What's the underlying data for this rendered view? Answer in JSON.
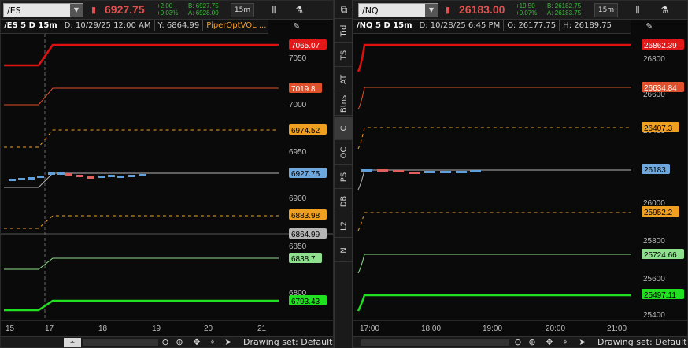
{
  "colors": {
    "red": "#e01010",
    "orange_red": "#e0502a",
    "orange_dash": "#f0a020",
    "gray_line": "#b5b5b5",
    "light_green": "#8ee08e",
    "green": "#20e020",
    "candle_up": "#5fa0dc",
    "candle_down": "#e06060"
  },
  "sidebar": {
    "top_icon": "⧉",
    "items": [
      "Trd",
      "TS",
      "AT",
      "Btns",
      "C",
      "OC",
      "PS",
      "DB",
      "L2",
      "N"
    ],
    "active": "C"
  },
  "left": {
    "symbol": "/ES",
    "price": "6927.75",
    "change": "+2.00",
    "change_pct": "+0.03%",
    "bid": "B: 6927.75",
    "ask": "A: 6928.00",
    "timeframe": "15m",
    "title": "/ES 5 D 15m",
    "info_date": "D: 10/29/25 12:00 AM",
    "info_y": "Y: 6864.99",
    "study": "PiperOptVOL ...",
    "axis_labels": [
      "7050",
      "7000",
      "6950",
      "6900",
      "6850",
      "6800"
    ],
    "level_labels": {
      "red": "7065.07",
      "orange_red": "7019.8",
      "orange_hi": "6974.52",
      "last": "6927.75",
      "orange_lo": "6883.98",
      "gray": "6864.99",
      "light_green": "6838.7",
      "green": "6793.43"
    },
    "x_labels": [
      "15",
      "17",
      "18",
      "19",
      "20",
      "21"
    ],
    "drawing_set": "Drawing set: Default"
  },
  "right": {
    "symbol": "/NQ",
    "price": "26183.00",
    "change": "+19.50",
    "change_pct": "+0.07%",
    "bid": "B: 26182.75",
    "ask": "A: 26183.75",
    "timeframe": "15m",
    "title": "/NQ 5 D 15m",
    "info_date": "D: 10/28/25 6:45 PM",
    "info_o": "O: 26177.75",
    "info_h": "H: 26189.75",
    "axis_labels": [
      "26800",
      "26600",
      "26400",
      "26200",
      "26000",
      "25800",
      "25600",
      "25400"
    ],
    "level_labels": {
      "red": "26862.39",
      "orange_red": "26634.84",
      "orange_hi": "26407.3",
      "last": "26183",
      "orange_lo": "25952.2",
      "light_green": "25724.66",
      "green": "25497.11"
    },
    "x_labels": [
      "17:00",
      "18:00",
      "19:00",
      "20:00",
      "21:00"
    ],
    "drawing_set": "Drawing set: Default"
  },
  "icons": {
    "dropdown": "▼",
    "alert": "▮",
    "candles": "⫼",
    "flask": "⚗",
    "draw": "✎",
    "zoom_out": "⊖",
    "zoom_in": "⊕",
    "pan": "✥",
    "crosshair": "⌖",
    "cursor": "➤",
    "scroll_home": "⏶"
  }
}
